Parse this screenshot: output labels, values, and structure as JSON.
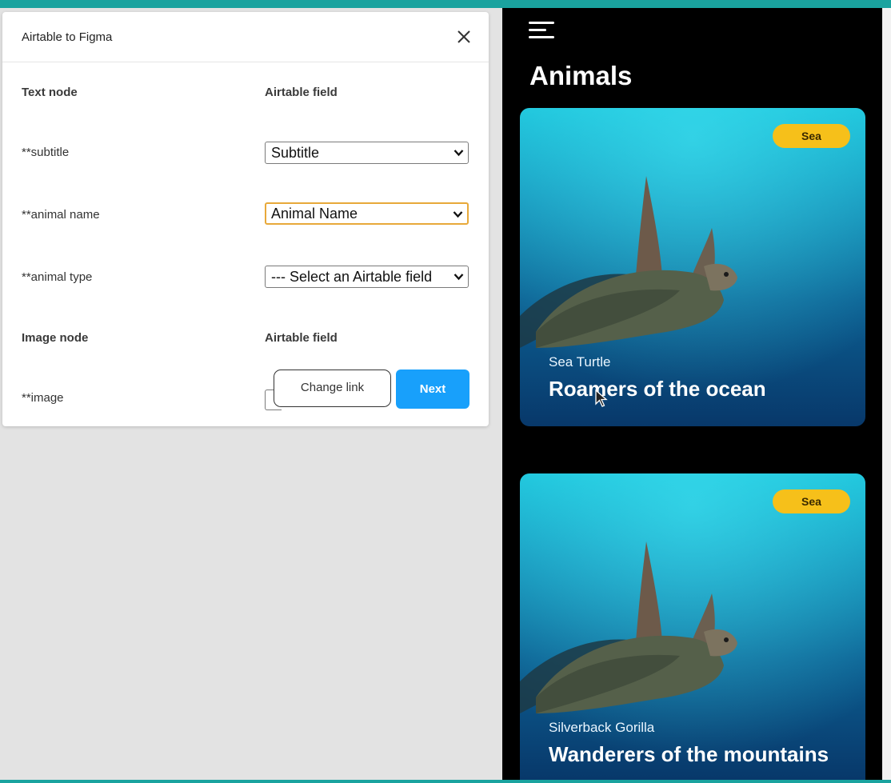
{
  "plugin": {
    "title": "Airtable to Figma",
    "text_section": {
      "col_node": "Text node",
      "col_field": "Airtable field",
      "rows": [
        {
          "node": "**subtitle",
          "field": "Subtitle"
        },
        {
          "node": "**animal name",
          "field": "Animal Name"
        },
        {
          "node": "**animal type",
          "field": "--- Select an Airtable field"
        }
      ]
    },
    "image_section": {
      "col_node": "Image node",
      "col_field": "Airtable field",
      "rows": [
        {
          "node": "**image"
        }
      ]
    },
    "change_link_label": "Change link",
    "next_label": "Next"
  },
  "preview": {
    "title": "Animals",
    "cards": [
      {
        "tag": "Sea",
        "subtitle": "Sea Turtle",
        "title": "Roamers of the ocean"
      },
      {
        "tag": "Sea",
        "subtitle": "Silverback Gorilla",
        "title": "Wanderers of the mountains"
      }
    ]
  },
  "colors": {
    "accent": "#18a0fb",
    "focus": "#e8a93a",
    "tag": "#f6c01a",
    "frame": "#1aa39f"
  },
  "icons": [
    "close-icon",
    "chevron-down-icon",
    "menu-icon",
    "cursor-icon"
  ]
}
